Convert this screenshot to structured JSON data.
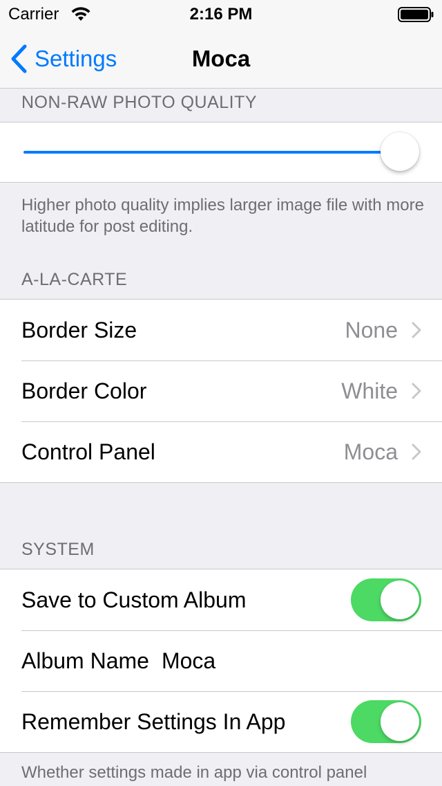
{
  "status_bar": {
    "carrier": "Carrier",
    "time": "2:16 PM",
    "wifi_icon": "wifi-icon",
    "battery_icon": "battery-icon"
  },
  "nav": {
    "back_label": "Settings",
    "title": "Moca",
    "accent_color": "#007aff"
  },
  "photo_quality": {
    "header": "NON-RAW PHOTO QUALITY",
    "slider_value": 1.0,
    "footer": "Higher photo quality implies larger image file with more latitude for post editing."
  },
  "a_la_carte": {
    "header": "A-LA-CARTE",
    "items": [
      {
        "label": "Border Size",
        "value": "None"
      },
      {
        "label": "Border Color",
        "value": "White"
      },
      {
        "label": "Control Panel",
        "value": "Moca"
      }
    ]
  },
  "system": {
    "header": "SYSTEM",
    "save_custom_album": {
      "label": "Save to Custom Album",
      "on": true
    },
    "album_name": {
      "label": "Album Name",
      "value": "Moca"
    },
    "remember_settings": {
      "label": "Remember Settings In App",
      "on": true
    },
    "footer": "Whether settings made in app via control panel",
    "toggle_color": "#4cd964"
  }
}
